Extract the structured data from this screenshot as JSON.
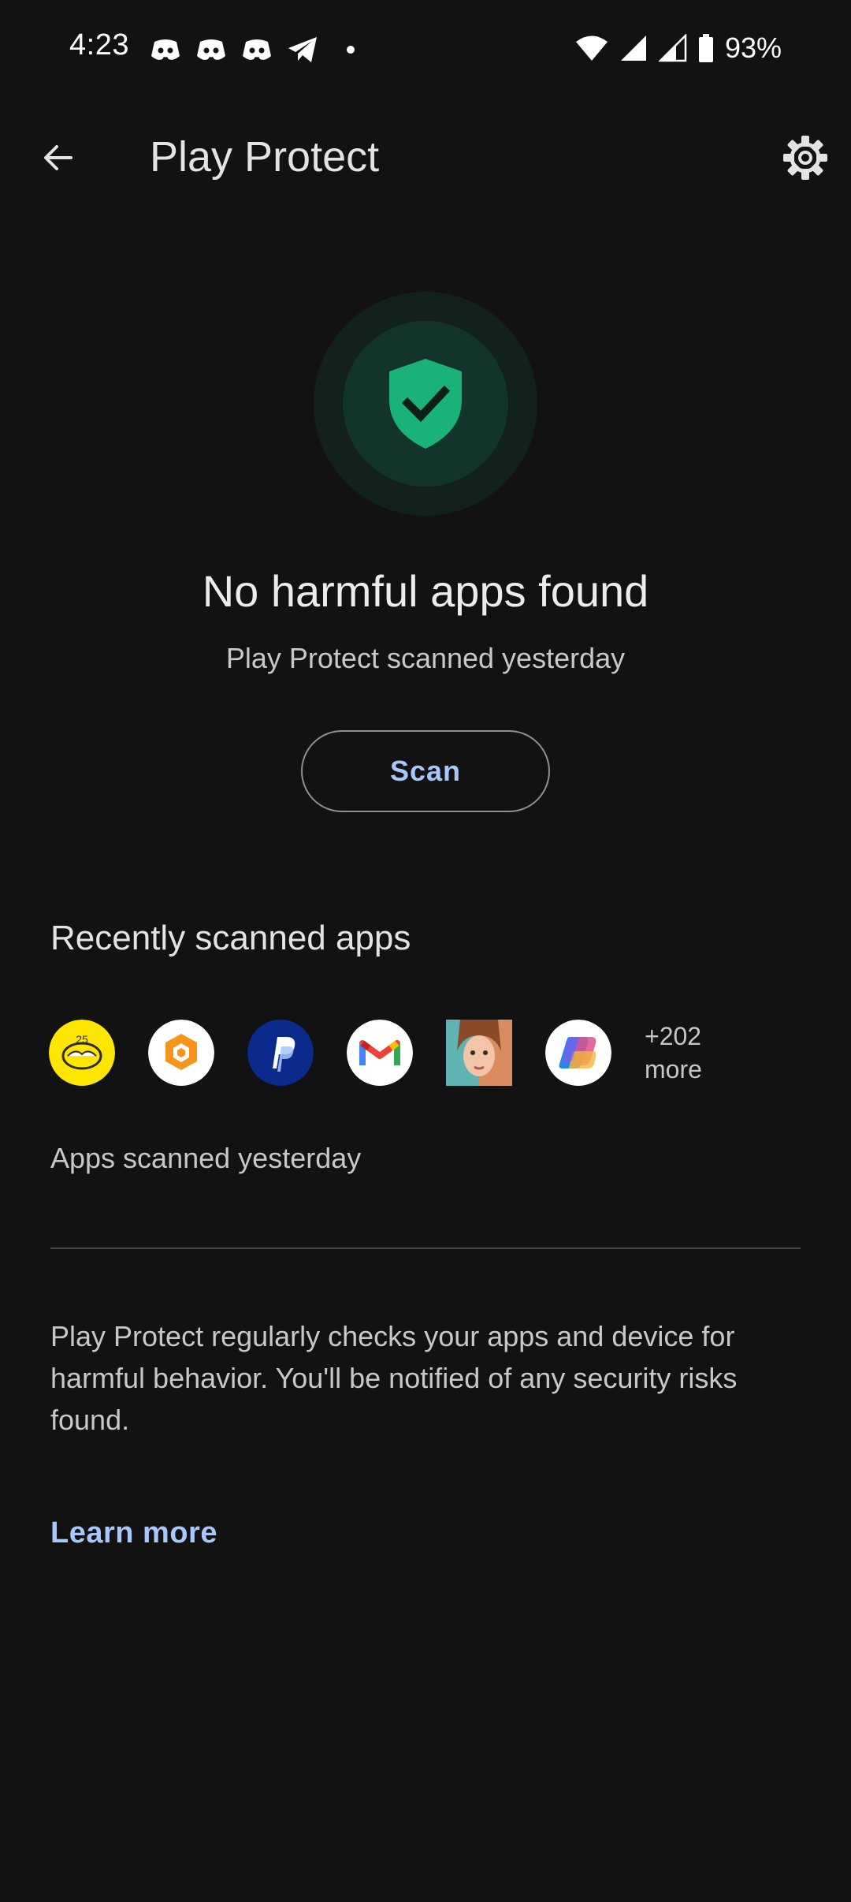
{
  "status_bar": {
    "time": "4:23",
    "battery_percent": "93%",
    "notification_icons": [
      "discord-icon",
      "discord-icon",
      "discord-icon",
      "telegram-icon",
      "dot-icon"
    ],
    "system_icons": [
      "wifi-icon",
      "signal-icon",
      "signal-icon",
      "battery-icon"
    ]
  },
  "app_bar": {
    "title": "Play Protect"
  },
  "status": {
    "headline": "No harmful apps found",
    "subtext": "Play Protect scanned yesterday",
    "scan_label": "Scan",
    "accent_color": "#19b37a"
  },
  "recent": {
    "title": "Recently scanned apps",
    "apps": [
      "app-icon-yellow-handshake",
      "app-icon-orange-cube",
      "paypal-icon",
      "gmail-icon",
      "app-icon-portrait",
      "copilot-icon"
    ],
    "more_line1": "+202",
    "more_line2": "more",
    "caption": "Apps scanned yesterday"
  },
  "info": {
    "description": "Play Protect regularly checks your apps and device for harmful behavior. You'll be notified of any security risks found.",
    "learn_more": "Learn more"
  }
}
